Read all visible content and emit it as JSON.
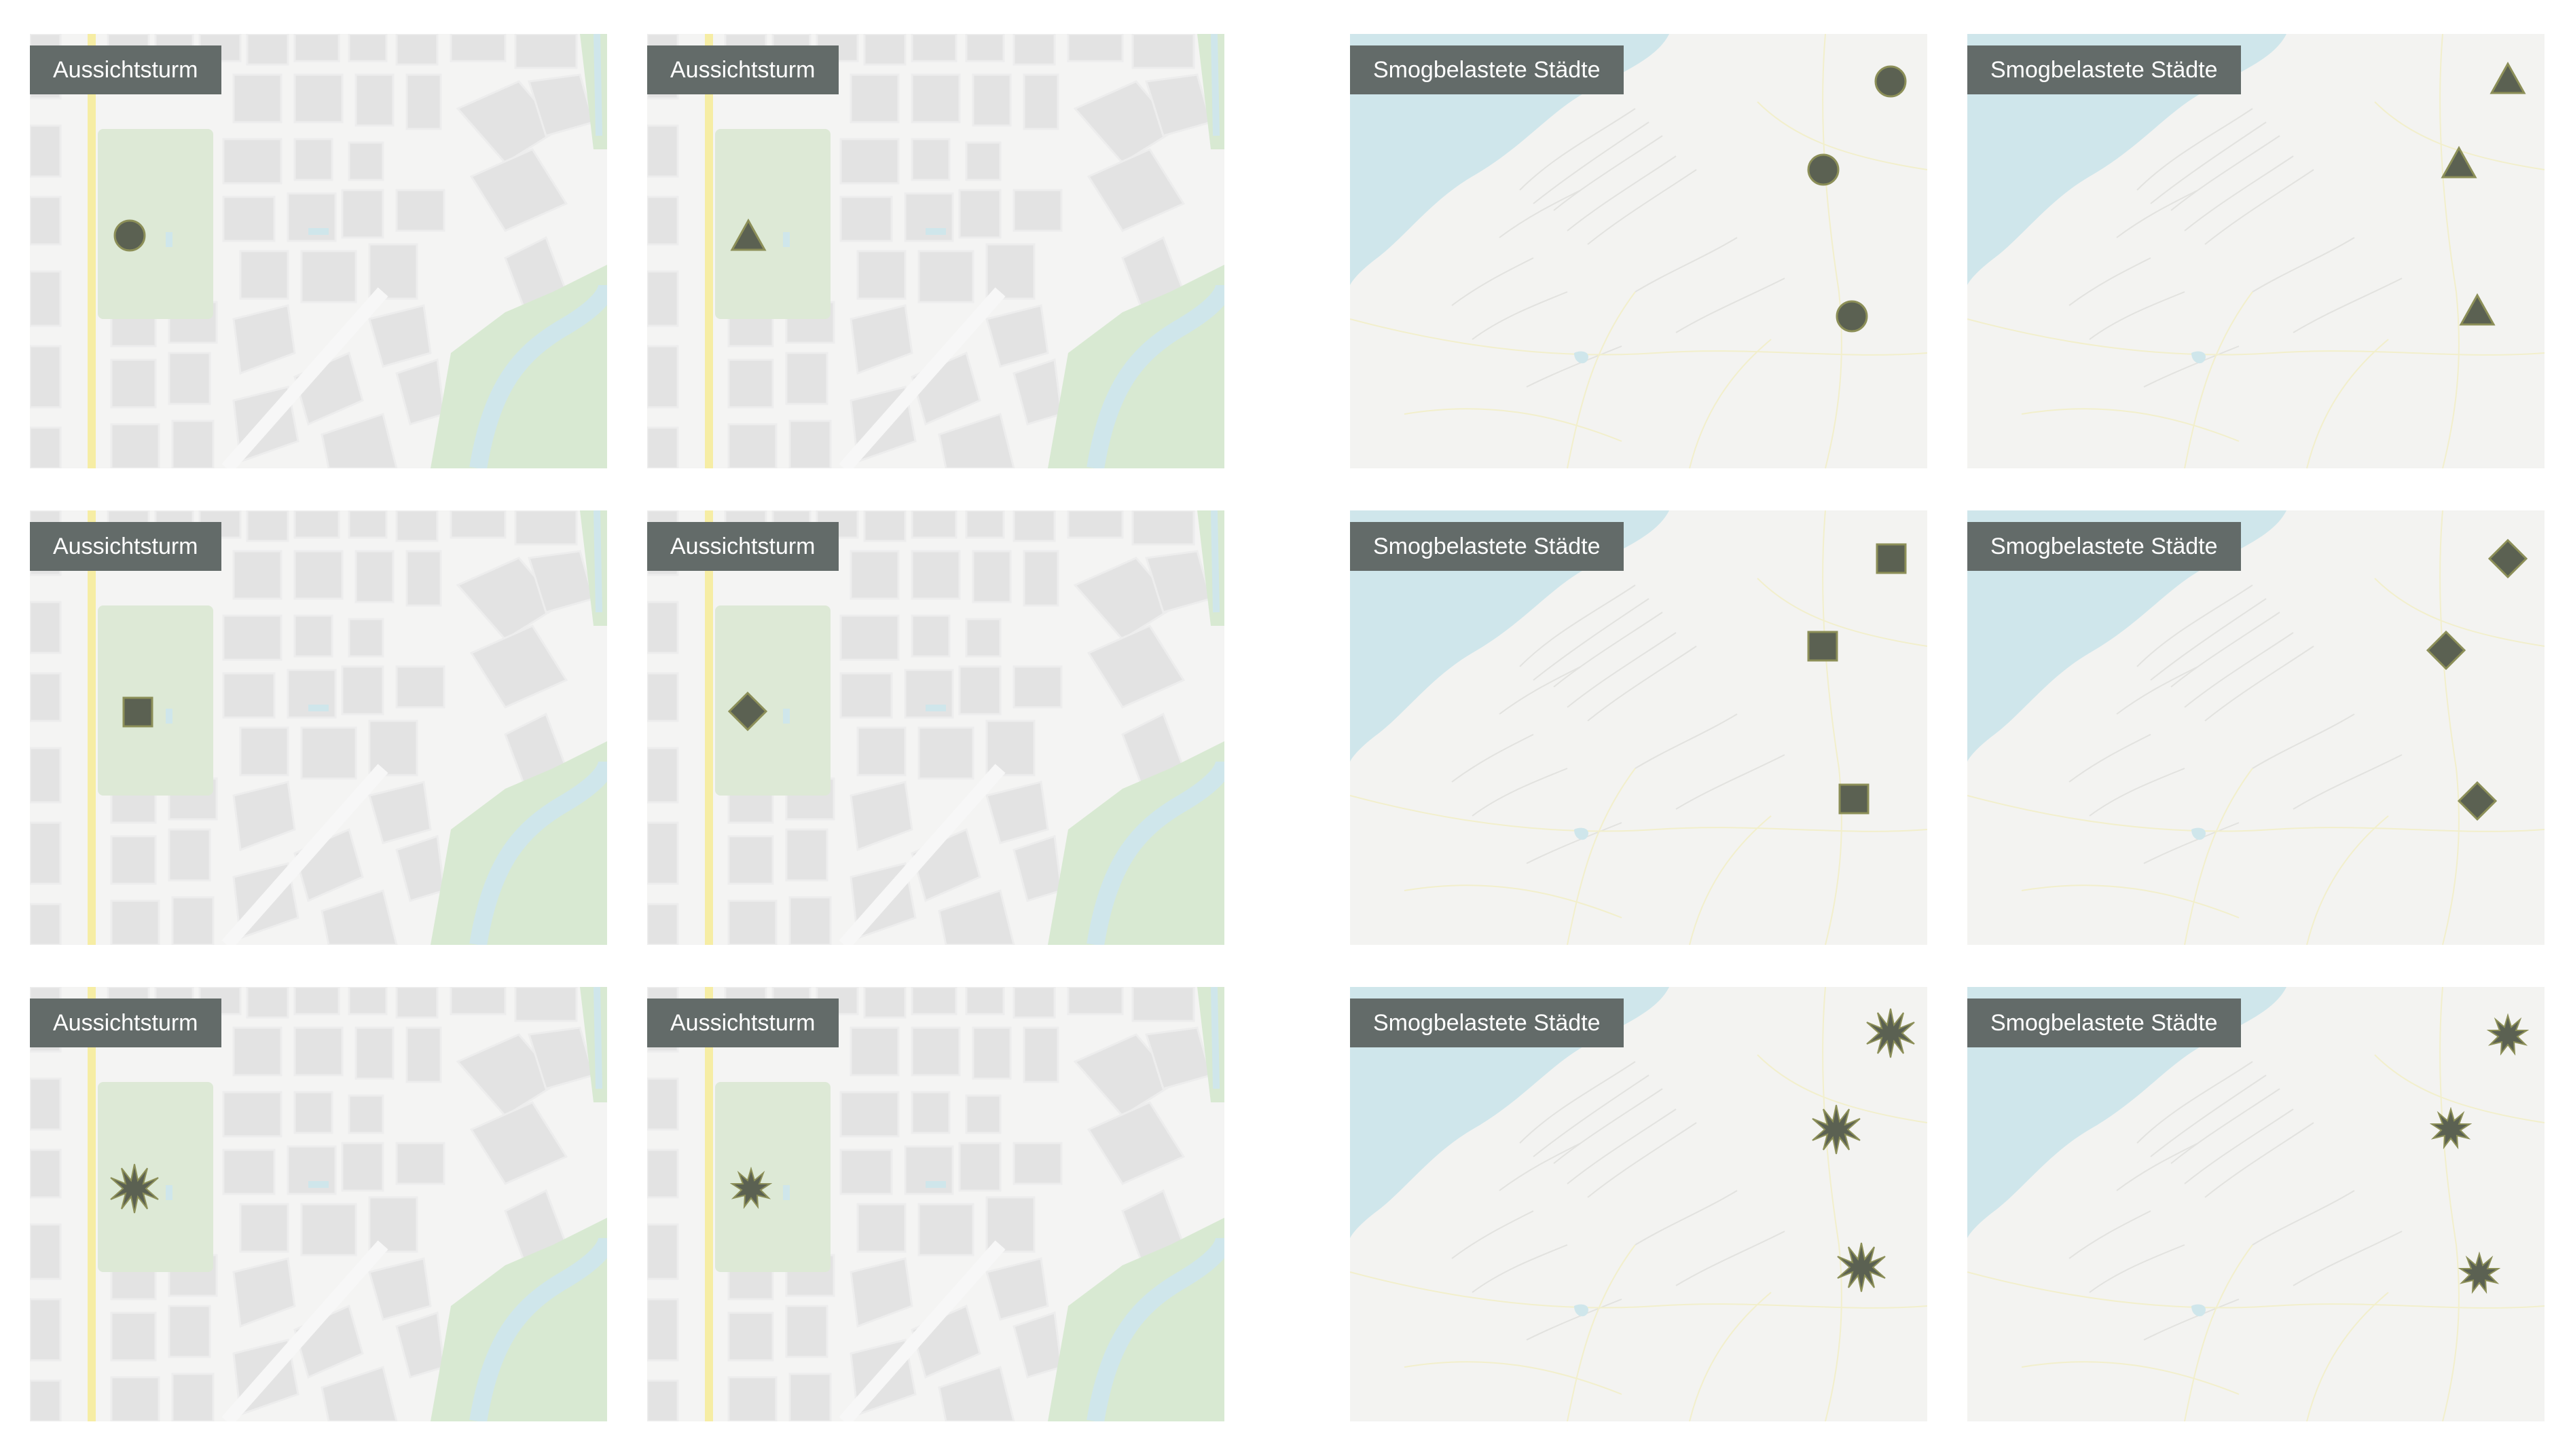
{
  "colors": {
    "label_bg": "#636b69",
    "label_text": "#ffffff",
    "marker_fill": "#5b6152",
    "marker_stroke": "#8c8f58",
    "street_bg": "#f4f4f3",
    "building": "#e2e2e2",
    "park": "#dde9d6",
    "main_road": "#f6eda4",
    "water": "#cfe6eb",
    "terrain": "#f1f1ef"
  },
  "street_panels": [
    {
      "label": "Aussichtsturm",
      "marker": "circle-icon"
    },
    {
      "label": "Aussichtsturm",
      "marker": "triangle-icon"
    },
    {
      "label": "Aussichtsturm",
      "marker": "square-icon"
    },
    {
      "label": "Aussichtsturm",
      "marker": "diamond-icon"
    },
    {
      "label": "Aussichtsturm",
      "marker": "starburst-icon"
    },
    {
      "label": "Aussichtsturm",
      "marker": "star-icon"
    }
  ],
  "region_panels": [
    {
      "label": "Smogbelastete Städte",
      "marker": "circle-icon"
    },
    {
      "label": "Smogbelastete Städte",
      "marker": "triangle-icon"
    },
    {
      "label": "Smogbelastete Städte",
      "marker": "square-icon"
    },
    {
      "label": "Smogbelastete Städte",
      "marker": "diamond-icon"
    },
    {
      "label": "Smogbelastete Städte",
      "marker": "starburst-icon"
    },
    {
      "label": "Smogbelastete Städte",
      "marker": "star-icon"
    }
  ]
}
